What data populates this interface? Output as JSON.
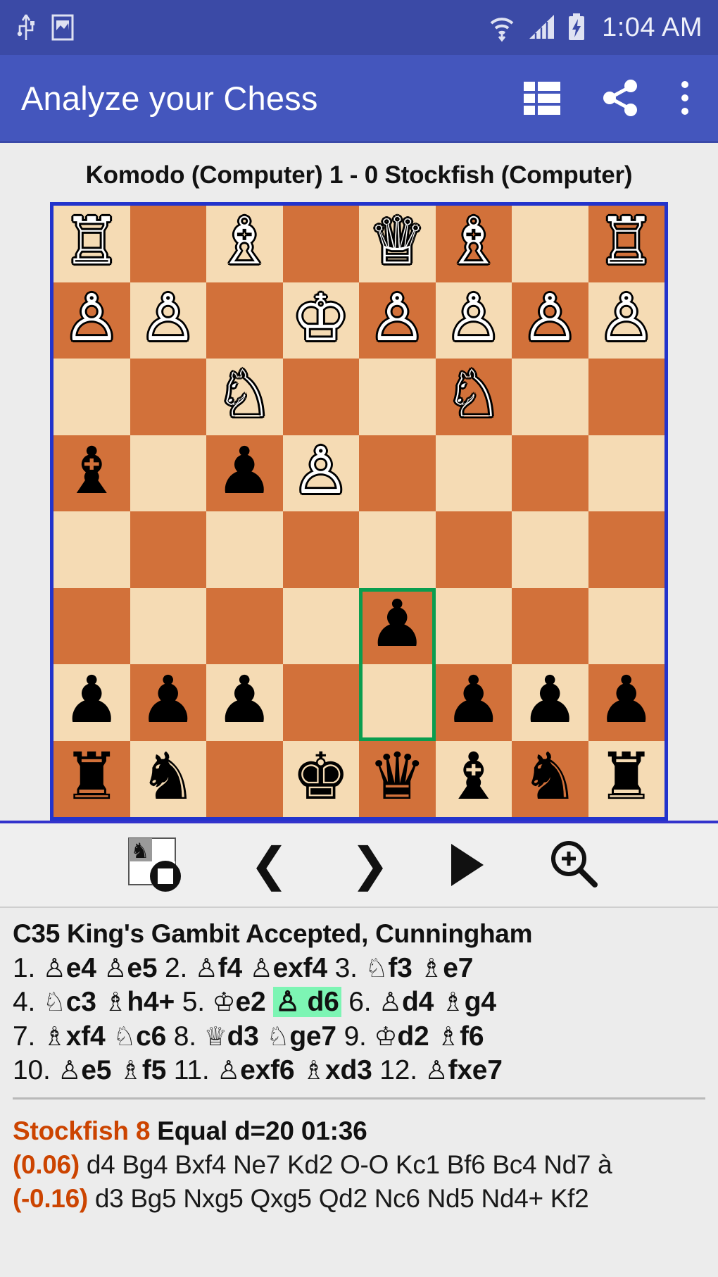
{
  "status_bar": {
    "time": "1:04 AM",
    "icons": [
      "usb-icon",
      "screenshot-icon",
      "wifi-icon",
      "signal-icon",
      "battery-charging-icon"
    ]
  },
  "app_bar": {
    "title": "Analyze your Chess",
    "actions": [
      {
        "name": "list-view-icon",
        "label": "List"
      },
      {
        "name": "share-icon",
        "label": "Share"
      },
      {
        "name": "overflow-menu-icon",
        "label": "More options"
      }
    ]
  },
  "game": {
    "players_line": "Komodo (Computer)  1 - 0  Stockfish (Computer)",
    "white_player": "Komodo (Computer)",
    "black_player": "Stockfish (Computer)",
    "result": "1 - 0"
  },
  "board": {
    "orientation": "black-at-bottom",
    "light_color": "#f5dbb4",
    "dark_color": "#d2713a",
    "border_color": "#2233cc",
    "highlight_color": "#0a9d4f",
    "highlight_squares": [
      "r5c4",
      "r6c4"
    ],
    "rows": [
      [
        "R",
        "",
        "B",
        "",
        "Q",
        "B",
        "",
        "R"
      ],
      [
        "P",
        "P",
        "",
        "K",
        "P",
        "P",
        "P",
        "P"
      ],
      [
        "",
        "",
        "N",
        "",
        "",
        "N",
        "",
        ""
      ],
      [
        "b",
        "",
        "p",
        "P",
        "",
        "",
        "",
        ""
      ],
      [
        "",
        "",
        "",
        "",
        "",
        "",
        "",
        ""
      ],
      [
        "",
        "",
        "",
        "",
        "p",
        "",
        "",
        ""
      ],
      [
        "p",
        "p",
        "p",
        "",
        "",
        "p",
        "p",
        "p"
      ],
      [
        "r",
        "n",
        "",
        "k",
        "q",
        "b",
        "n",
        "r"
      ]
    ],
    "glyphs": {
      "K": "♔",
      "Q": "♕",
      "R": "♖",
      "B": "♗",
      "N": "♘",
      "P": "♙",
      "k": "♚",
      "q": "♛",
      "r": "♜",
      "b": "♝",
      "n": "♞",
      "p": "♟"
    }
  },
  "controls": [
    {
      "name": "flip-board-icon",
      "label": "Flip board"
    },
    {
      "name": "previous-move-icon",
      "label": "❮"
    },
    {
      "name": "next-move-icon",
      "label": "❯"
    },
    {
      "name": "play-icon",
      "label": "Play"
    },
    {
      "name": "zoom-in-icon",
      "label": "Zoom"
    }
  ],
  "moves": {
    "opening": "C35 King's Gambit Accepted, Cunningham",
    "lines": [
      [
        {
          "t": "num",
          "v": "1."
        },
        {
          "t": "fig",
          "v": "♙"
        },
        {
          "t": "san",
          "v": "e4"
        },
        {
          "t": "fig",
          "v": "♙"
        },
        {
          "t": "san",
          "v": "e5"
        },
        {
          "t": "num",
          "v": "2."
        },
        {
          "t": "fig",
          "v": "♙"
        },
        {
          "t": "san",
          "v": "f4"
        },
        {
          "t": "fig",
          "v": "♙"
        },
        {
          "t": "san",
          "v": "exf4"
        },
        {
          "t": "num",
          "v": "3."
        },
        {
          "t": "fig",
          "v": "♘"
        },
        {
          "t": "san",
          "v": "f3"
        },
        {
          "t": "fig",
          "v": "♗"
        },
        {
          "t": "san",
          "v": "e7"
        }
      ],
      [
        {
          "t": "num",
          "v": "4."
        },
        {
          "t": "fig",
          "v": "♘"
        },
        {
          "t": "san",
          "v": "c3"
        },
        {
          "t": "fig",
          "v": "♗"
        },
        {
          "t": "san",
          "v": "h4+"
        },
        {
          "t": "num",
          "v": "5."
        },
        {
          "t": "fig",
          "v": "♔"
        },
        {
          "t": "san",
          "v": "e2"
        },
        {
          "t": "cur",
          "v": "♙ d6"
        },
        {
          "t": "num",
          "v": "6."
        },
        {
          "t": "fig",
          "v": "♙"
        },
        {
          "t": "san",
          "v": "d4"
        },
        {
          "t": "fig",
          "v": "♗"
        },
        {
          "t": "san",
          "v": "g4"
        }
      ],
      [
        {
          "t": "num",
          "v": "7."
        },
        {
          "t": "fig",
          "v": "♗"
        },
        {
          "t": "san",
          "v": "xf4"
        },
        {
          "t": "fig",
          "v": "♘"
        },
        {
          "t": "san",
          "v": "c6"
        },
        {
          "t": "num",
          "v": "8."
        },
        {
          "t": "fig",
          "v": "♕"
        },
        {
          "t": "san",
          "v": "d3"
        },
        {
          "t": "fig",
          "v": "♘"
        },
        {
          "t": "san",
          "v": "ge7"
        },
        {
          "t": "num",
          "v": "9."
        },
        {
          "t": "fig",
          "v": "♔"
        },
        {
          "t": "san",
          "v": "d2"
        },
        {
          "t": "fig",
          "v": "♗"
        },
        {
          "t": "san",
          "v": "f6"
        }
      ],
      [
        {
          "t": "num",
          "v": "10."
        },
        {
          "t": "fig",
          "v": "♙"
        },
        {
          "t": "san",
          "v": "e5"
        },
        {
          "t": "fig",
          "v": "♗"
        },
        {
          "t": "san",
          "v": "f5"
        },
        {
          "t": "num",
          "v": "11."
        },
        {
          "t": "fig",
          "v": "♙"
        },
        {
          "t": "san",
          "v": "exf6"
        },
        {
          "t": "fig",
          "v": "♗"
        },
        {
          "t": "san",
          "v": "xd3"
        },
        {
          "t": "num",
          "v": "12."
        },
        {
          "t": "fig",
          "v": "♙"
        },
        {
          "t": "san",
          "v": "fxe7"
        }
      ]
    ],
    "current_move": "d6"
  },
  "engine": {
    "name": "Stockfish 8",
    "eval_text": "Equal",
    "depth": "d=20",
    "time": "01:36",
    "lines": [
      {
        "score": "(0.06)",
        "pv": "d4 Bg4 Bxf4 Ne7 Kd2 O-O Kc1 Bf6 Bc4 Nd7 à"
      },
      {
        "score": "(-0.16)",
        "pv": "d3 Bg5 Nxg5 Qxg5 Qd2 Nc6 Nd5 Nd4+ Kf2"
      }
    ]
  }
}
